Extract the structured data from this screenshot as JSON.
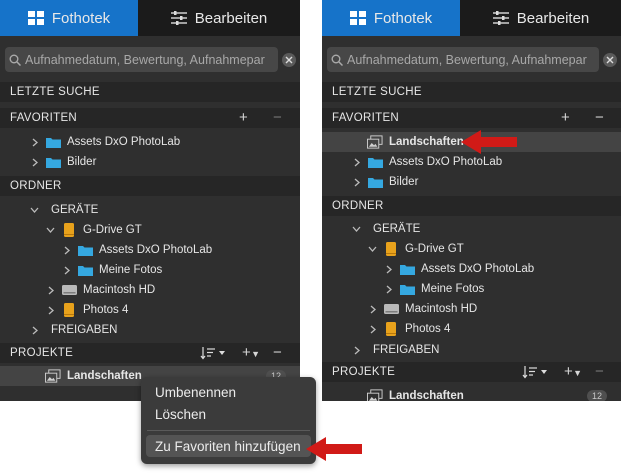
{
  "tabs": {
    "library": "Fothotek",
    "edit": "Bearbeiten"
  },
  "search": {
    "placeholder": "Aufnahmedatum, Bewertung, Aufnahmepar"
  },
  "sections": {
    "recent": "LETZTE SUCHE",
    "favorites": "FAVORITEN",
    "folders": "ORDNER",
    "projects": "PROJEKTE"
  },
  "left": {
    "favorites": [
      "Assets DxO PhotoLab",
      "Bilder"
    ],
    "folders": {
      "devices": "GERÄTE",
      "drive": "G-Drive GT",
      "drive_children": [
        "Assets DxO PhotoLab",
        "Meine Fotos"
      ],
      "mac": "Macintosh HD",
      "photos": "Photos 4",
      "shares": "FREIGABEN"
    },
    "project": {
      "name": "Landschaften",
      "count": "12"
    }
  },
  "context_menu": {
    "rename": "Umbenennen",
    "delete": "Löschen",
    "add_favorite": "Zu Favoriten hinzufügen"
  },
  "right": {
    "favorites": [
      "Landschaften",
      "Assets DxO PhotoLab",
      "Bilder"
    ],
    "folders": {
      "devices": "GERÄTE",
      "drive": "G-Drive GT",
      "drive_children": [
        "Assets DxO PhotoLab",
        "Meine Fotos"
      ],
      "mac": "Macintosh HD",
      "photos": "Photos 4",
      "shares": "FREIGABEN"
    },
    "project": {
      "name": "Landschaften",
      "count": "12"
    }
  },
  "icons": {
    "library": "grid-icon",
    "edit": "sliders-icon",
    "search": "magnifier-icon",
    "clear": "close-icon",
    "chevron": "chevron-right-icon",
    "folder": "folder-icon",
    "drive": "drive-icon",
    "project": "stack-icon",
    "annotation": "red-arrow-icon"
  },
  "colors": {
    "accent": "#1673c9",
    "folder": "#35a8e0",
    "drive": "#e8a21c",
    "arrow": "#d11a17",
    "panel": "#2f2f2f"
  }
}
